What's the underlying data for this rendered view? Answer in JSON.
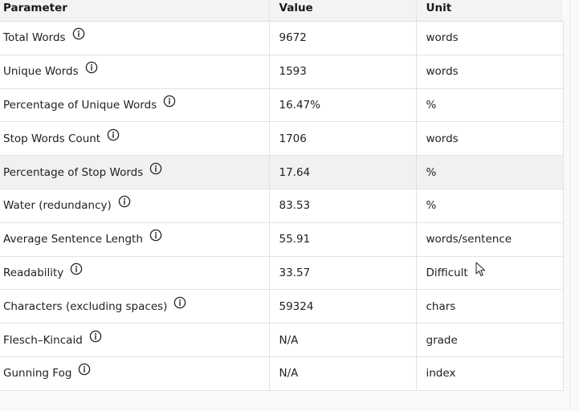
{
  "table": {
    "headers": [
      "Parameter",
      "Value",
      "Unit"
    ],
    "rows": [
      {
        "parameter": "Total Words",
        "value": "9672",
        "unit": "words"
      },
      {
        "parameter": "Unique Words",
        "value": "1593",
        "unit": "words"
      },
      {
        "parameter": "Percentage of Unique Words",
        "value": "16.47%",
        "unit": "%"
      },
      {
        "parameter": "Stop Words Count",
        "value": "1706",
        "unit": "words"
      },
      {
        "parameter": "Percentage of Stop Words",
        "value": "17.64",
        "unit": "%"
      },
      {
        "parameter": "Water (redundancy)",
        "value": "83.53",
        "unit": "%"
      },
      {
        "parameter": "Average Sentence Length",
        "value": "55.91",
        "unit": "words/sentence"
      },
      {
        "parameter": "Readability",
        "value": "33.57",
        "unit": "Difficult"
      },
      {
        "parameter": "Characters (excluding spaces)",
        "value": "59324",
        "unit": "chars"
      },
      {
        "parameter": "Flesch–Kincaid",
        "value": "N/A",
        "unit": "grade"
      },
      {
        "parameter": "Gunning Fog",
        "value": "N/A",
        "unit": "index"
      }
    ],
    "hovered_row": 4
  },
  "icons": {
    "row_info": "info-circle-icon",
    "cursor": "mouse-pointer-icon"
  },
  "colors": {
    "header_bg": "#f3f3f3",
    "hover_bg": "#f1f1f1",
    "border": "#e2e2e2"
  }
}
